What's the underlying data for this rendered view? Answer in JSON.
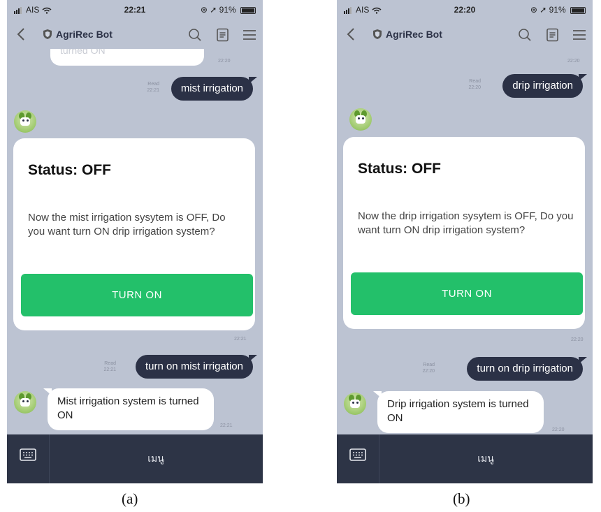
{
  "panels": [
    {
      "caption": "(a)",
      "status_bar": {
        "carrier": "AIS",
        "time": "22:21",
        "battery": "91%"
      },
      "header": {
        "title": "AgriRec Bot"
      },
      "top_partial_text": "turned ON",
      "top_partial_time": "22:20",
      "user_message_1": {
        "text": "mist irrigation",
        "read_label": "Read",
        "time": "22:21"
      },
      "card": {
        "title": "Status: OFF",
        "body": "Now the mist irrigation sysytem is OFF, Do you want turn ON drip irrigation system?",
        "button_label": "TURN ON",
        "time": "22:21"
      },
      "user_message_2": {
        "text": "turn on mist irrigation",
        "read_label": "Read",
        "time": "22:21"
      },
      "bot_reply": {
        "text": "Mist irrigation system is turned ON",
        "time": "22:21"
      },
      "bottom_bar": {
        "menu_label": "เมนู"
      }
    },
    {
      "caption": "(b)",
      "status_bar": {
        "carrier": "AIS",
        "time": "22:20",
        "battery": "91%"
      },
      "header": {
        "title": "AgriRec Bot"
      },
      "top_partial_text": "",
      "top_partial_time": "22:20",
      "user_message_1": {
        "text": "drip irrigation",
        "read_label": "Read",
        "time": "22:20"
      },
      "card": {
        "title": "Status: OFF",
        "body": "Now the drip irrigation sysytem is OFF, Do you want turn ON drip irrigation system?",
        "button_label": "TURN ON",
        "time": "22:20"
      },
      "user_message_2": {
        "text": "turn on drip irrigation",
        "read_label": "Read",
        "time": "22:20"
      },
      "bot_reply": {
        "text": "Drip irrigation system is turned ON",
        "time": "22:20"
      },
      "bottom_bar": {
        "menu_label": "เมนู"
      }
    }
  ],
  "colors": {
    "chat_background": "#bcc3d2",
    "user_bubble": "#2b3146",
    "turn_on_button": "#23c06a",
    "bottom_bar": "#2d3446"
  }
}
